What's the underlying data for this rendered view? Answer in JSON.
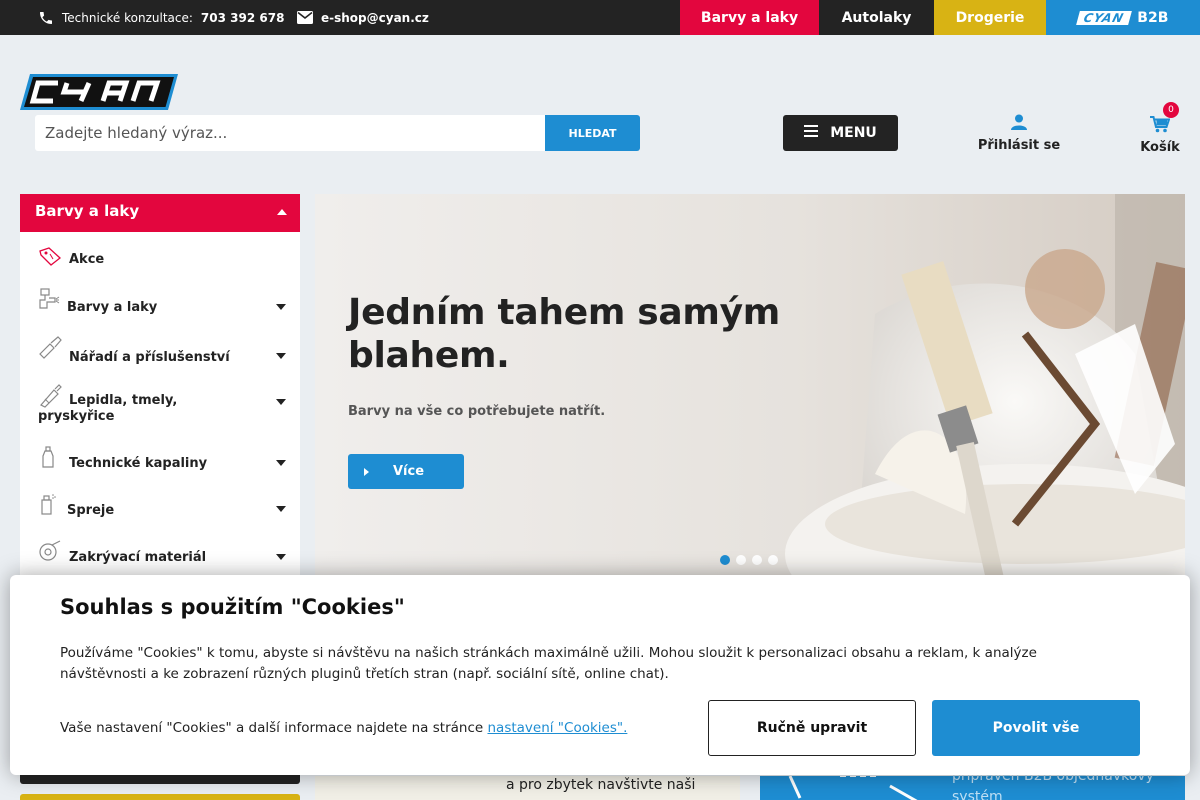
{
  "topbar": {
    "phone_label": "Technické konzultace:",
    "phone_number": "703 392 678",
    "email": "e-shop@cyan.cz",
    "tabs": [
      {
        "label": "Barvy a laky"
      },
      {
        "label": "Autolaky"
      },
      {
        "label": "Drogerie"
      },
      {
        "label": "B2B",
        "logo_text": "CYAN"
      }
    ]
  },
  "header": {
    "logo_text": "CYAN",
    "search_placeholder": "Zadejte hledaný výraz...",
    "search_button": "HLEDAT",
    "menu_label": "MENU",
    "login_label": "Přihlásit se",
    "cart_label": "Košík",
    "cart_count": "0"
  },
  "sidebar": {
    "title": "Barvy a laky",
    "items": [
      {
        "label": "Akce",
        "icon": "tag-icon",
        "has_children": false
      },
      {
        "label": "Barvy a laky",
        "icon": "spray-gun-icon",
        "has_children": true
      },
      {
        "label": "Nářadí a příslušenství",
        "icon": "brush-icon",
        "has_children": true
      },
      {
        "label": "Lepidla, tmely, pryskyřice",
        "icon": "glue-icon",
        "has_children": true
      },
      {
        "label": "Technické kapaliny",
        "icon": "bottle-icon",
        "has_children": true
      },
      {
        "label": "Spreje",
        "icon": "spray-can-icon",
        "has_children": true
      },
      {
        "label": "Zakrývací materiál",
        "icon": "tape-icon",
        "has_children": true
      }
    ]
  },
  "hero": {
    "title": "Jedním tahem samým blahem.",
    "subtitle": "Barvy na vše co potřebujete natřít.",
    "button": "Více",
    "slides": 4,
    "active_slide": 1
  },
  "promos": {
    "left_text": "a pro zbytek navštivte naši",
    "right_text": "připraven B2B objednávkový systém"
  },
  "cookie": {
    "title": "Souhlas s použitím \"Cookies\"",
    "text": "Používáme \"Cookies\" k tomu, abyste si návštěvu na našich stránkách maximálně užili. Mohou sloužit k personalizaci obsahu a reklam, k analýze návštěvnosti a ke zobrazení různých pluginů třetích stran (např. sociální sítě, online chat).",
    "note": "Vaše nastavení \"Cookies\" a další informace najdete na stránce",
    "note_link": "nastavení \"Cookies\".",
    "btn_manual": "Ručně upravit",
    "btn_allow": "Povolit vše"
  },
  "colors": {
    "red": "#e3063e",
    "blue": "#1e8dd2",
    "yellow": "#d8b314",
    "dark": "#232323"
  }
}
